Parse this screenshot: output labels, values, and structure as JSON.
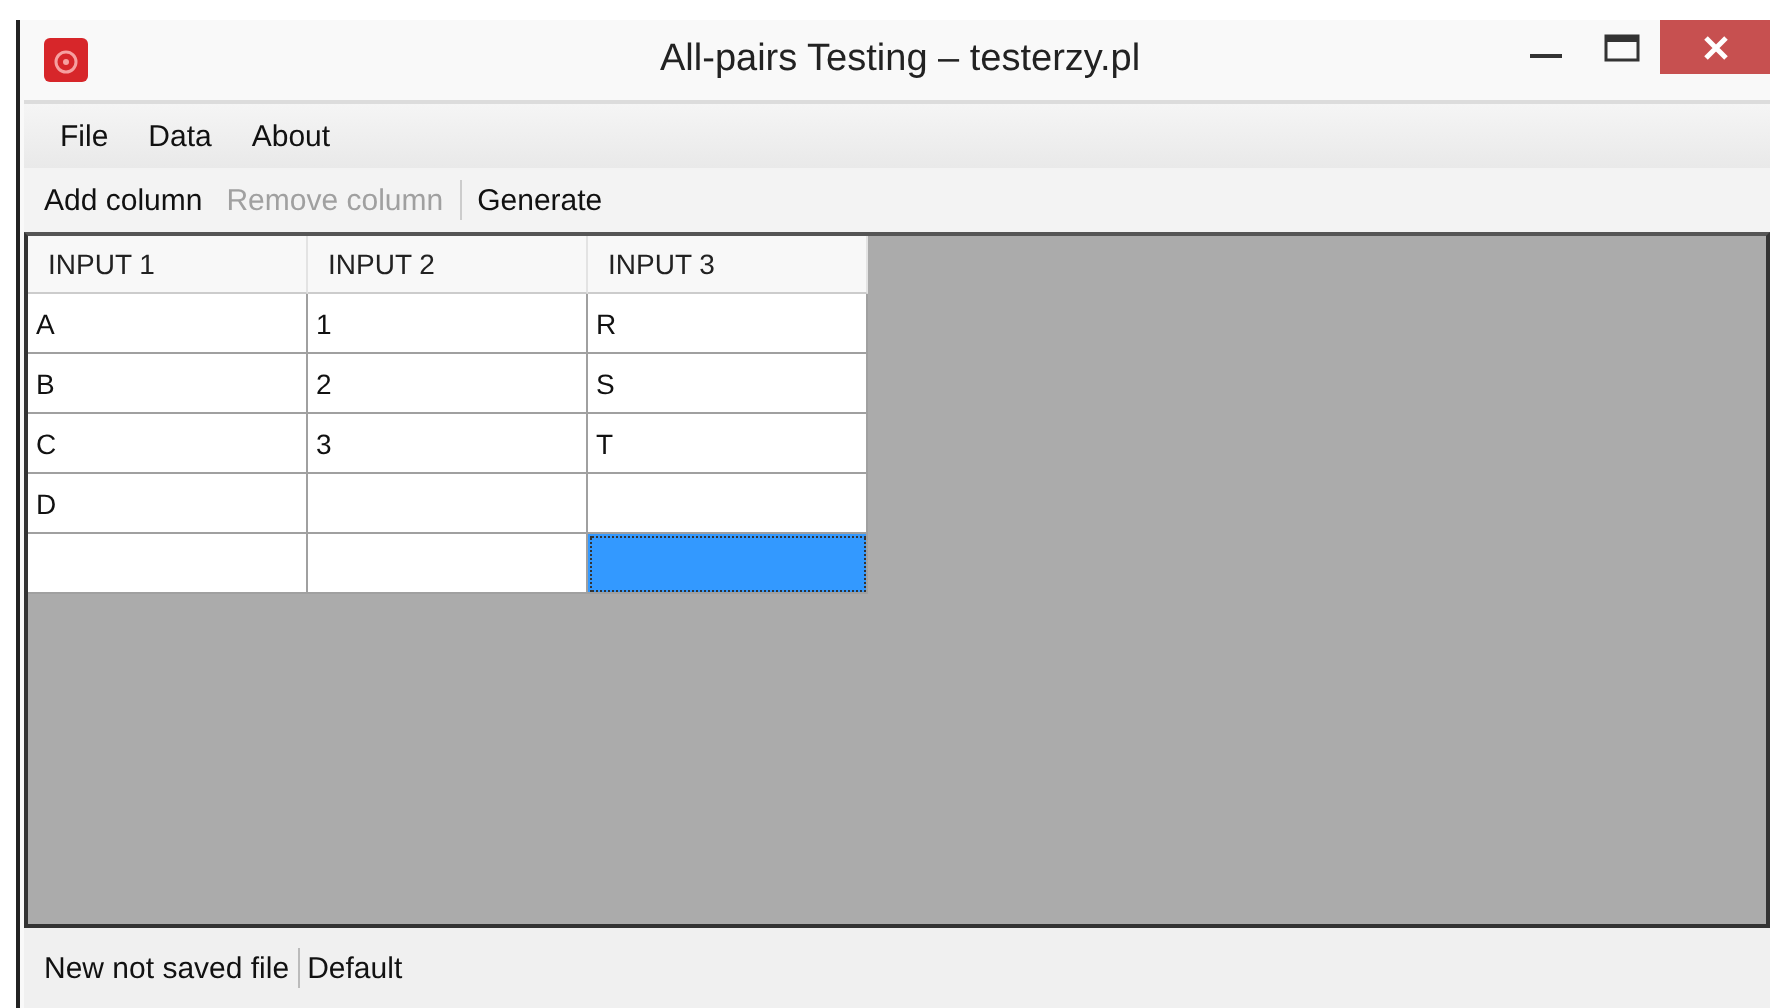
{
  "window": {
    "title": "All-pairs Testing – testerzy.pl"
  },
  "menu": [
    "File",
    "Data",
    "About"
  ],
  "toolbar": [
    {
      "label": "Add column",
      "disabled": false
    },
    {
      "label": "Remove column",
      "disabled": true
    },
    {
      "label": "Generate",
      "disabled": false
    }
  ],
  "table": {
    "columns": [
      "INPUT 1",
      "INPUT 2",
      "INPUT 3"
    ],
    "rows": [
      [
        {
          "text": "A",
          "selected": false
        },
        {
          "text": "1",
          "selected": false
        },
        {
          "text": "R",
          "selected": false
        }
      ],
      [
        {
          "text": "B",
          "selected": false
        },
        {
          "text": "2",
          "selected": false
        },
        {
          "text": "S",
          "selected": false
        }
      ],
      [
        {
          "text": "C",
          "selected": false
        },
        {
          "text": "3",
          "selected": false
        },
        {
          "text": "T",
          "selected": false
        }
      ],
      [
        {
          "text": "D",
          "selected": false
        },
        {
          "text": "",
          "selected": false
        },
        {
          "text": "",
          "selected": false
        }
      ],
      [
        {
          "text": "",
          "selected": false
        },
        {
          "text": "",
          "selected": false
        },
        {
          "text": "",
          "selected": true
        }
      ]
    ]
  },
  "status_bar": [
    "New not saved file",
    "Default"
  ]
}
